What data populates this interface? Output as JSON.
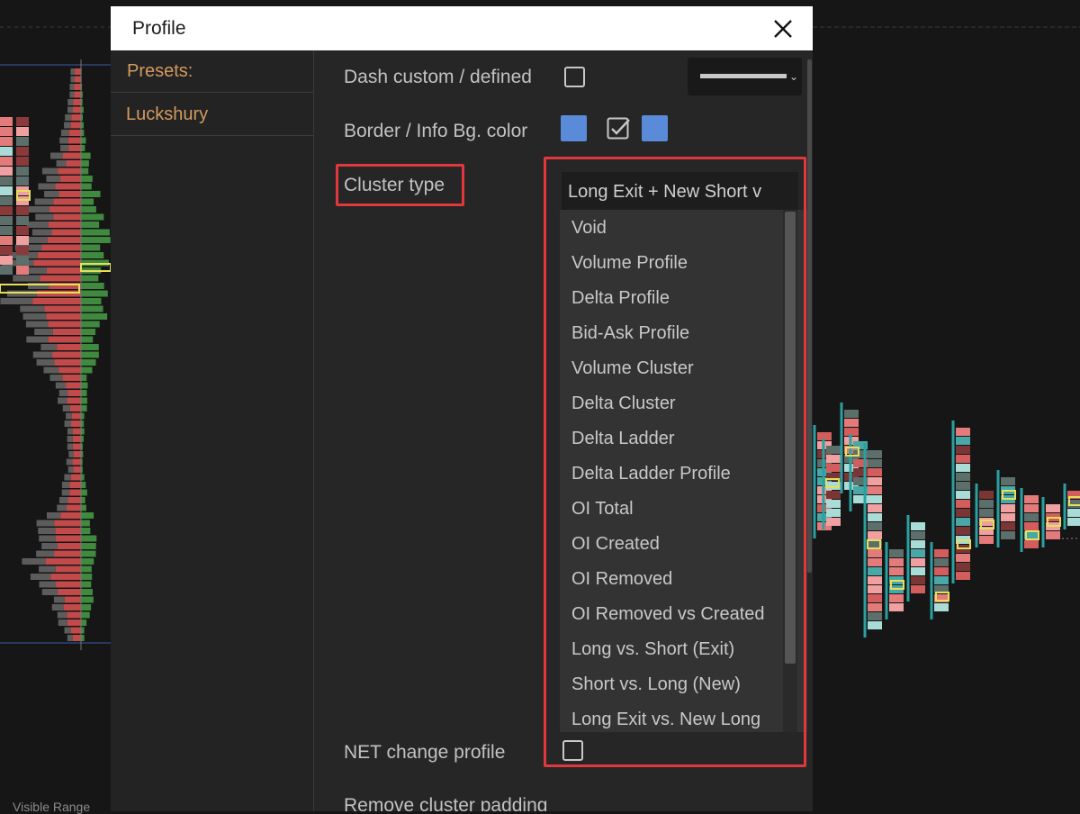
{
  "dialog": {
    "title": "Profile",
    "close_icon": "close-icon"
  },
  "sidebar": {
    "items": [
      {
        "label": "Presets:"
      },
      {
        "label": "Luckshury"
      }
    ]
  },
  "settings": {
    "dash_label": "Dash custom / defined",
    "border_label": "Border / Info Bg. color",
    "cluster_label": "Cluster type",
    "cluster_value": "Long Exit + New Short v",
    "net_change_label": "NET change profile",
    "remove_padding_label": "Remove cluster padding"
  },
  "colors": {
    "swatch": "#5a8bd8",
    "highlight": "#e0383d",
    "sidebar_text": "#d39a5f"
  },
  "cluster_options": [
    "Void",
    "Volume Profile",
    "Delta Profile",
    "Bid-Ask Profile",
    "Volume Cluster",
    "Delta Cluster",
    "Delta Ladder",
    "Delta Ladder Profile",
    "OI Total",
    "OI Created",
    "OI Removed",
    "OI Removed vs Created",
    "Long vs. Short (Exit)",
    "Short vs. Long (New)",
    "Long Exit vs. New Long"
  ],
  "background": {
    "bottom_label": "Visible Range"
  }
}
